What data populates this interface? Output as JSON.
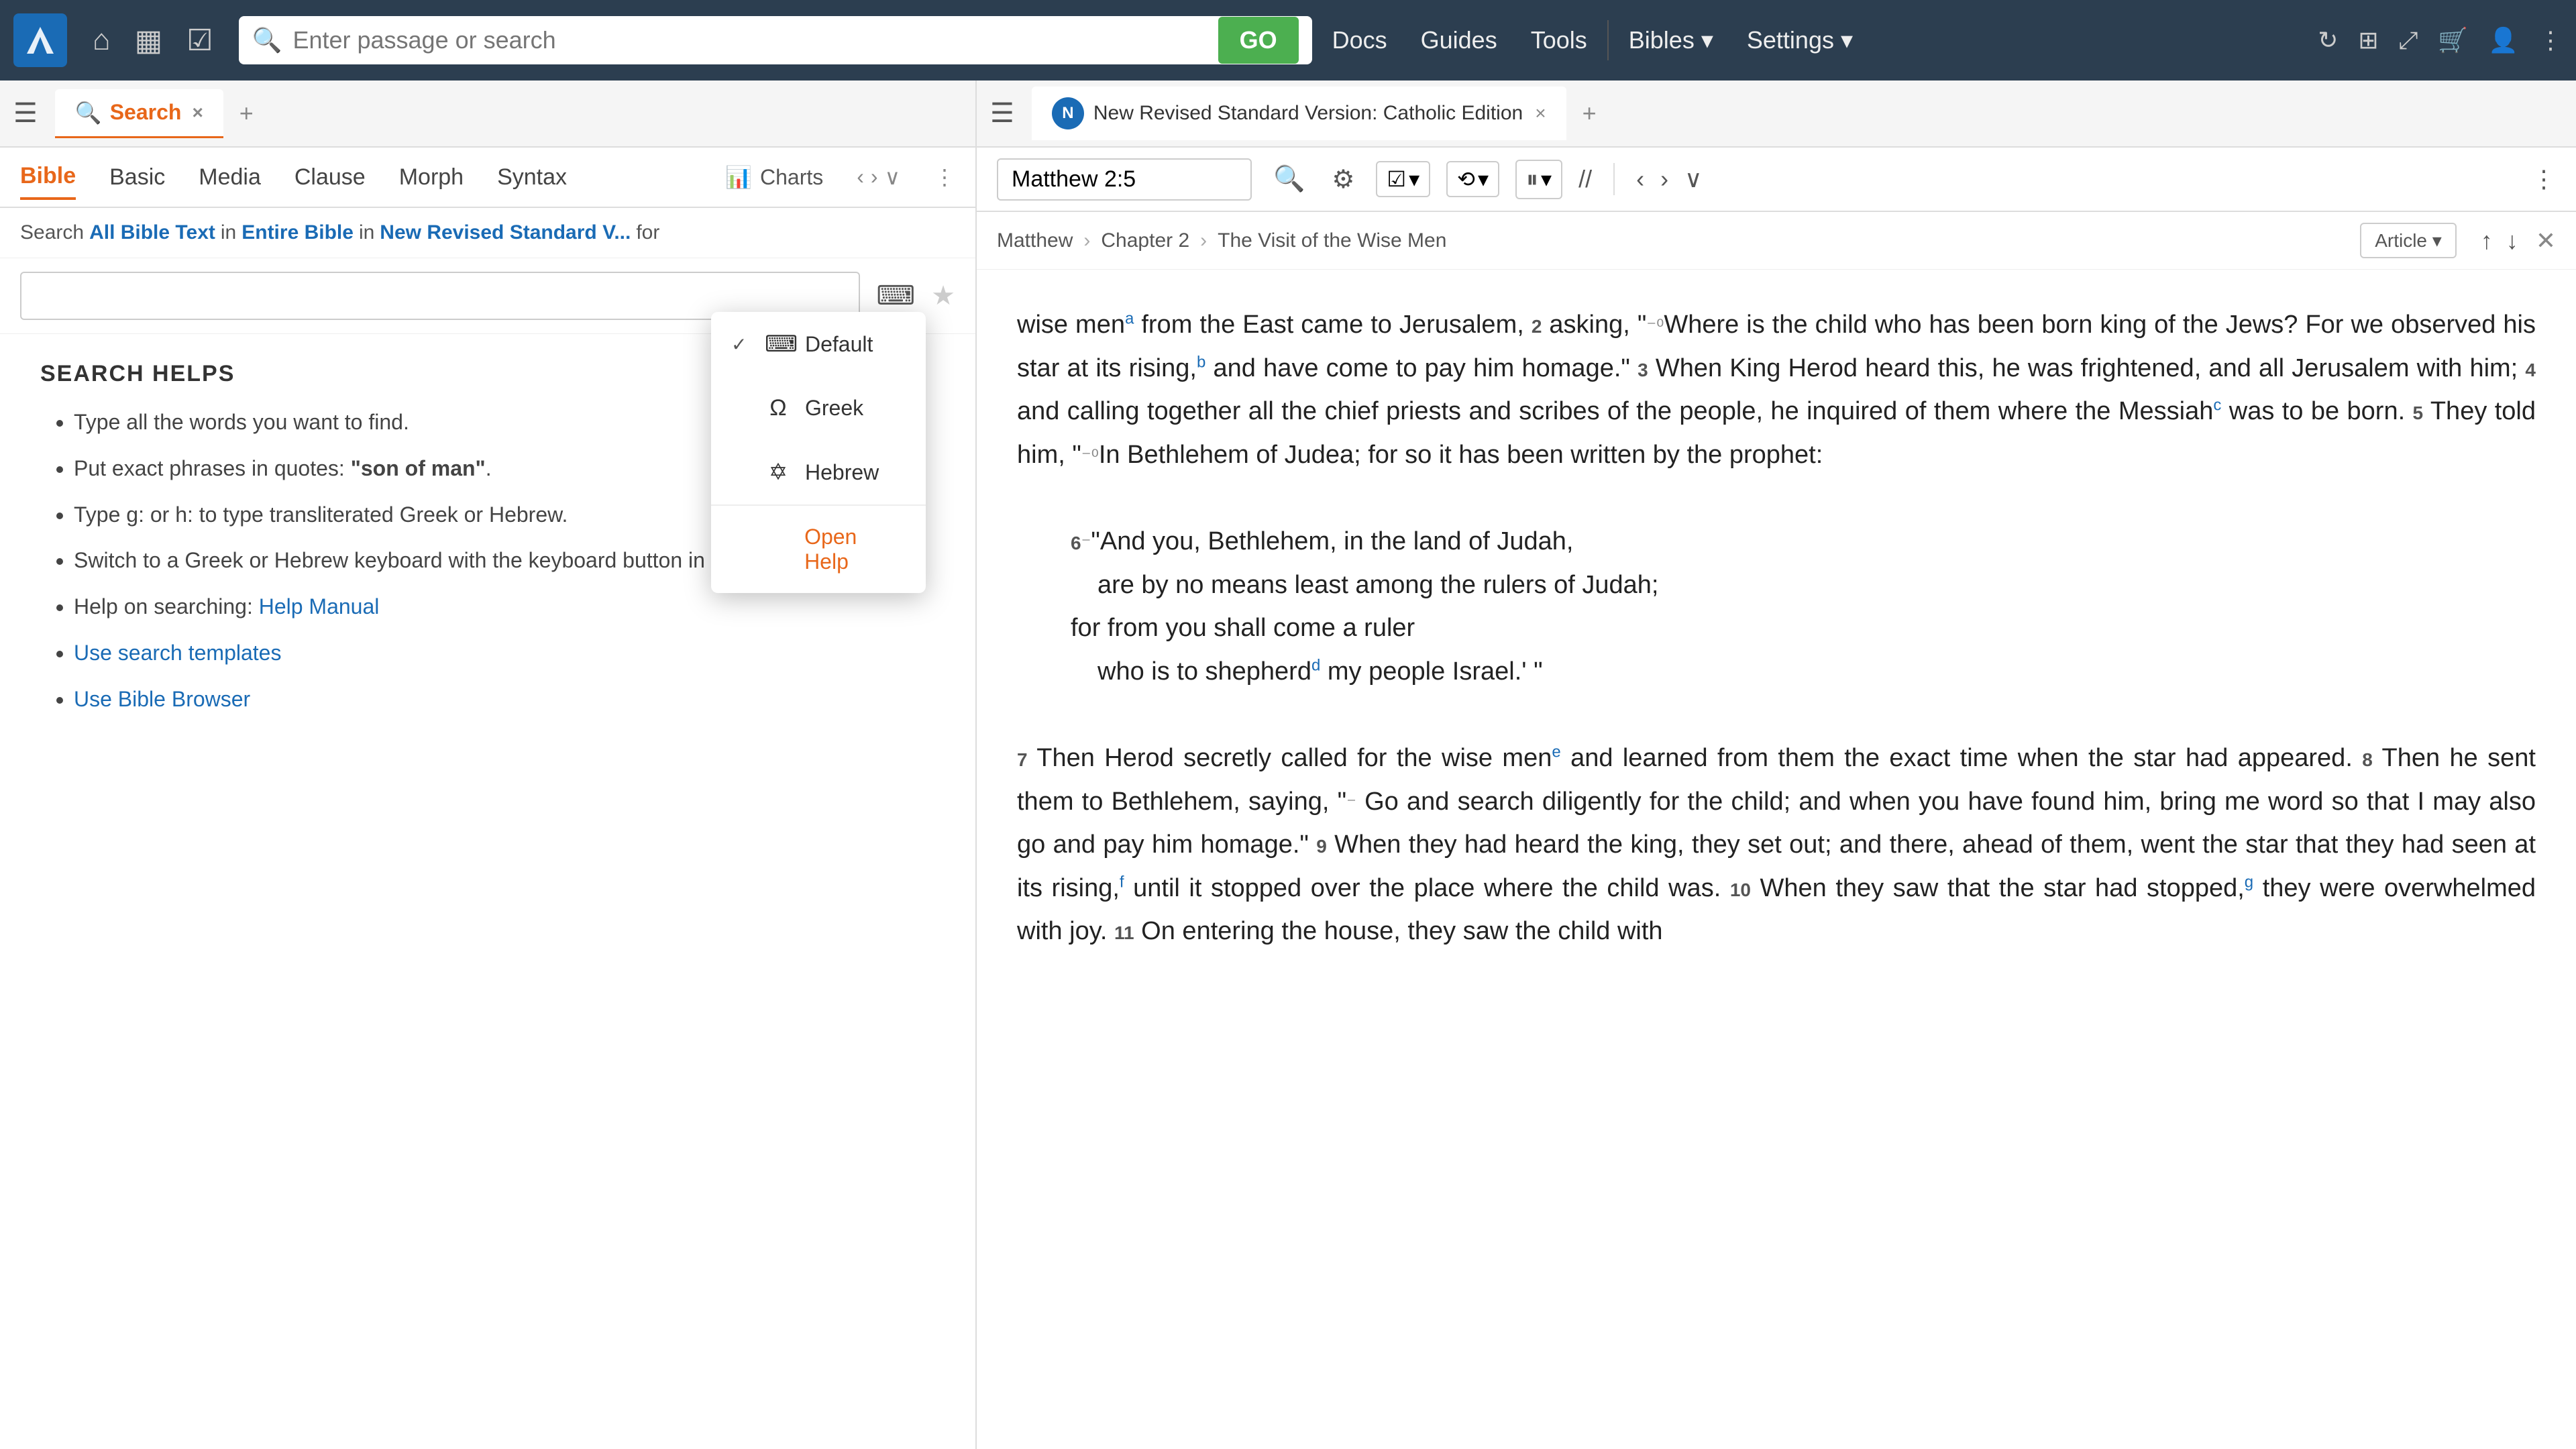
{
  "app": {
    "title": "Logos Bible Software"
  },
  "topnav": {
    "search_placeholder": "Enter passage or search",
    "go_label": "GO",
    "links": [
      "Docs",
      "Guides",
      "Tools",
      "Bibles ▾",
      "Settings ▾"
    ]
  },
  "left_panel": {
    "tab": {
      "icon": "search",
      "label": "Search",
      "close": "×"
    },
    "subtabs": [
      "Bible",
      "Basic",
      "Media",
      "Clause",
      "Morph",
      "Syntax"
    ],
    "active_subtab": "Bible",
    "charts_label": "Charts",
    "search_context": {
      "prefix": "Search",
      "scope1": "All Bible Text",
      "in1": "in",
      "scope2": "Entire Bible",
      "in2": "in",
      "scope3": "New Revised Standard V...",
      "suffix": "for"
    },
    "search_helps": {
      "heading": "SEARCH HELPS",
      "items": [
        "Type all the words you want to find.",
        "Put exact phrases in quotes: \"son of man\".",
        "Type g: or h: to type transliterated Greek or Hebrew.",
        "Switch to a Greek or Hebrew keyboard with the keyboard button in the search box.",
        "Help on searching: Help Manual",
        "Use search templates",
        "Use Bible Browser"
      ]
    }
  },
  "keyboard_dropdown": {
    "items": [
      {
        "checked": true,
        "icon": "⌨",
        "label": "Default"
      },
      {
        "checked": false,
        "icon": "Ω",
        "label": "Greek"
      },
      {
        "checked": false,
        "icon": "✡",
        "label": "Hebrew"
      }
    ],
    "link_label": "Open Help"
  },
  "right_panel": {
    "tab": {
      "label": "New Revised Standard Version: Catholic Edition",
      "close": "×"
    },
    "passage": "Matthew 2:5",
    "breadcrumb": {
      "book": "Matthew",
      "chapter": "Chapter 2",
      "section": "The Visit of the Wise Men"
    },
    "article_btn": "Article ▾",
    "bible_text": "wise men from the East came to Jerusalem, 2 asking, \"Where is the child who has been born king of the Jews? For we observed his star at its rising, and have come to pay him homage.\" 3 When King Herod heard this, he was frightened, and all Jerusalem with him; 4 and calling together all the chief priests and scribes of the people, he inquired of them where the Messiah was to be born. 5 They told him, \"In Bethlehem of Judea; for so it has been written by the prophet:",
    "poetry": {
      "line1": "6 \"And you, Bethlehem, in the land of Judah,",
      "line2": "are by no means least among the rulers of Judah;",
      "line3": "for from you shall come a ruler",
      "line4": "who is to shepherd my people Israel.' \""
    },
    "bible_text2": "7 Then Herod secretly called for the wise men and learned from them the exact time when the star had appeared. 8 Then he sent them to Bethlehem, saying, \" Go and search diligently for the child; and when you have found him, bring me word so that I may also go and pay him homage.\" 9 When they had heard the king, they set out; and there, ahead of them, went the star that they had seen at its rising, until it stopped over the place where the child was. 10 When they saw that the star had stopped, they were overwhelmed with joy. 11 On entering the house, they saw the child with"
  }
}
